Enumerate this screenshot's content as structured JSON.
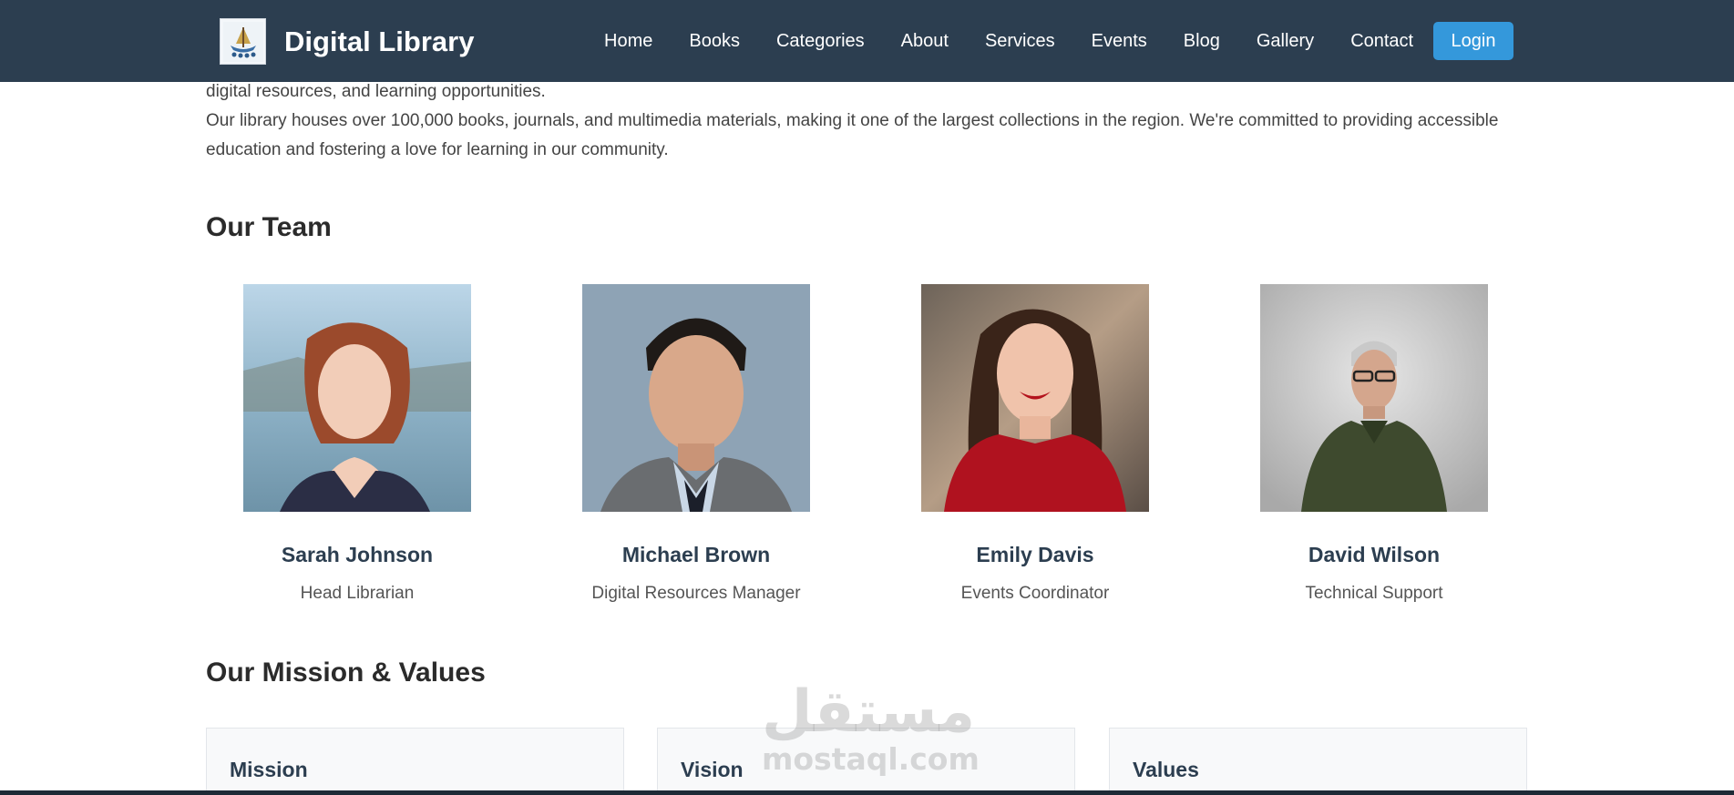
{
  "navbar": {
    "brand": "Digital Library",
    "links": [
      "Home",
      "Books",
      "Categories",
      "About",
      "Services",
      "Events",
      "Blog",
      "Gallery",
      "Contact"
    ],
    "login_label": "Login"
  },
  "intro": {
    "line1": "digital resources, and learning opportunities.",
    "paragraph2": "Our library houses over 100,000 books, journals, and multimedia materials, making it one of the largest collections in the region. We're committed to providing accessible education and fostering a love for learning in our community."
  },
  "team": {
    "title": "Our Team",
    "members": [
      {
        "name": "Sarah Johnson",
        "role": "Head Librarian"
      },
      {
        "name": "Michael Brown",
        "role": "Digital Resources Manager"
      },
      {
        "name": "Emily Davis",
        "role": "Events Coordinator"
      },
      {
        "name": "David Wilson",
        "role": "Technical Support"
      }
    ]
  },
  "mission": {
    "title": "Our Mission & Values",
    "cards": [
      "Mission",
      "Vision",
      "Values"
    ]
  },
  "watermark": {
    "arabic": "مستقل",
    "latin": "mostaql.com"
  },
  "colors": {
    "navbar": "#2c3e50",
    "accent": "#3498db",
    "card_bg": "#f8f9fa"
  }
}
